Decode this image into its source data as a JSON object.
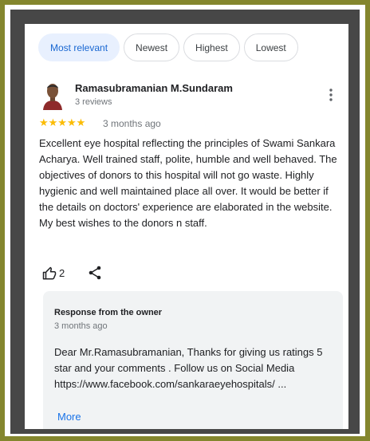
{
  "filters": {
    "most_relevant": "Most relevant",
    "newest": "Newest",
    "highest": "Highest",
    "lowest": "Lowest"
  },
  "review": {
    "reviewer_name": "Ramasubramanian M.Sundaram",
    "review_count": "3 reviews",
    "stars": "★★★★★",
    "rating": 5,
    "date": "3 months ago",
    "text": "Excellent eye hospital reflecting the principles of Swami Sankara Acharya.  Well trained staff, polite, humble and well behaved.  The objectives of donors to this hospital will not go waste.  Highly hygienic and well maintained place all over.  It would be better if the details on doctors' experience are elaborated in the website. My best wishes to the donors n staff.",
    "likes": "2"
  },
  "owner_response": {
    "title": "Response from the owner",
    "date": "3 months ago",
    "text": "Dear Mr.Ramasubramanian, Thanks for giving us ratings 5 star and your comments . Follow us on Social Media https://www.facebook.com/sankaraeyehospitals/ ...",
    "more_label": "More"
  },
  "colors": {
    "frame_olive": "#84862e",
    "frame_dark": "#474747",
    "star": "#fbbc04",
    "link": "#1a73e8",
    "chip_active_bg": "#e8f0fe",
    "chip_active_text": "#1967d2"
  }
}
